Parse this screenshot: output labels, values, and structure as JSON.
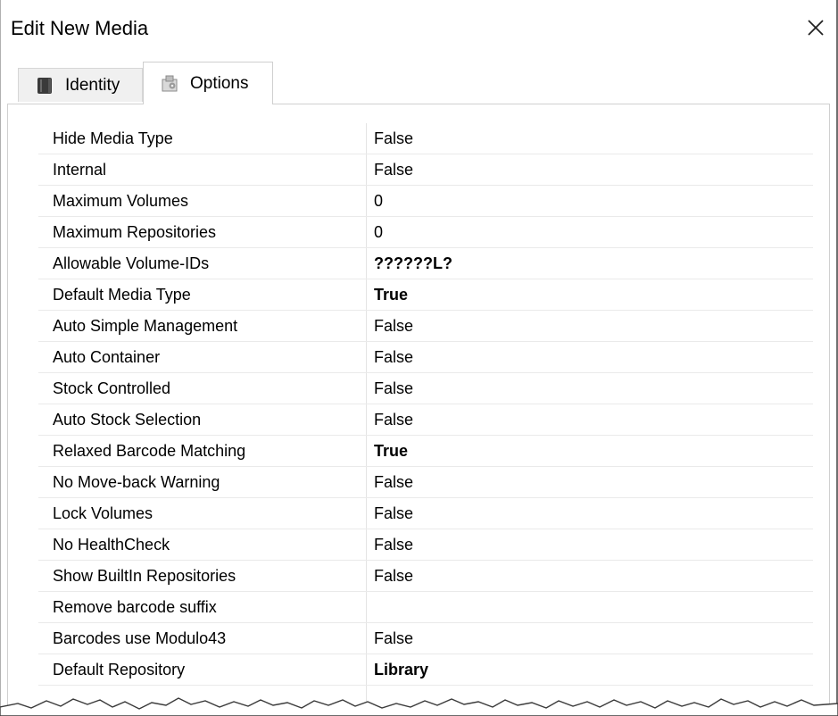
{
  "window": {
    "title": "Edit New Media"
  },
  "tabs": [
    {
      "label": "Identity",
      "icon": "book-icon",
      "active": false
    },
    {
      "label": "Options",
      "icon": "settings-icon",
      "active": true
    }
  ],
  "properties": [
    {
      "label": "Hide Media Type",
      "value": "False",
      "bold": false
    },
    {
      "label": "Internal",
      "value": "False",
      "bold": false
    },
    {
      "label": "Maximum Volumes",
      "value": "0",
      "bold": false
    },
    {
      "label": "Maximum Repositories",
      "value": "0",
      "bold": false
    },
    {
      "label": "Allowable Volume-IDs",
      "value": "??????L?",
      "bold": true
    },
    {
      "label": "Default Media Type",
      "value": "True",
      "bold": true
    },
    {
      "label": "Auto Simple Management",
      "value": "False",
      "bold": false
    },
    {
      "label": "Auto Container",
      "value": "False",
      "bold": false
    },
    {
      "label": "Stock Controlled",
      "value": "False",
      "bold": false
    },
    {
      "label": "Auto Stock Selection",
      "value": "False",
      "bold": false
    },
    {
      "label": "Relaxed Barcode Matching",
      "value": "True",
      "bold": true
    },
    {
      "label": "No Move-back Warning",
      "value": "False",
      "bold": false
    },
    {
      "label": "Lock Volumes",
      "value": "False",
      "bold": false
    },
    {
      "label": "No HealthCheck",
      "value": "False",
      "bold": false
    },
    {
      "label": "Show BuiltIn Repositories",
      "value": "False",
      "bold": false
    },
    {
      "label": "Remove barcode suffix",
      "value": "",
      "bold": false
    },
    {
      "label": "Barcodes use Modulo43",
      "value": "False",
      "bold": false
    },
    {
      "label": "Default Repository",
      "value": "Library",
      "bold": true
    }
  ]
}
